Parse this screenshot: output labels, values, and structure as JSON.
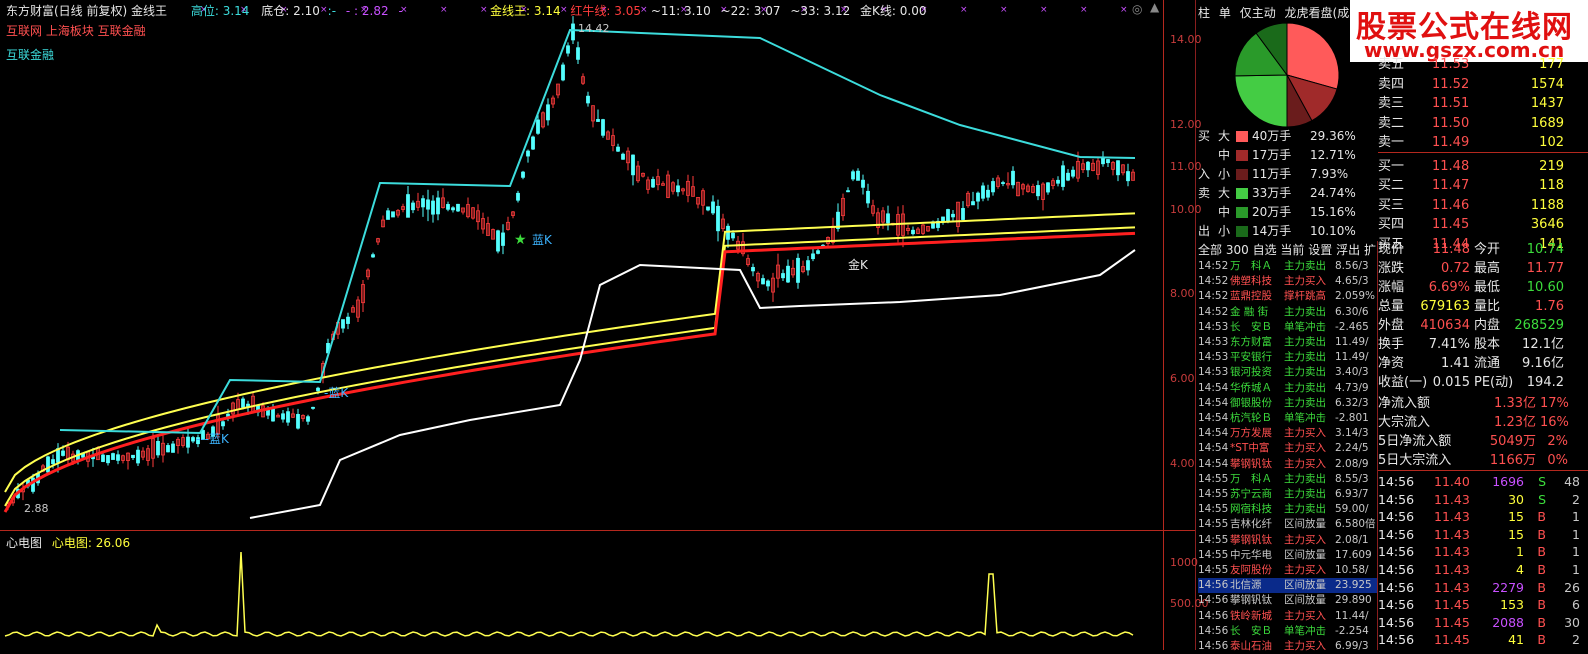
{
  "header": {
    "title": "东方财富(日线 前复权) 金线王",
    "high_label": "高位:",
    "high_value": "3.14",
    "low_label": "底仓:",
    "low_value": "2.10",
    "t3": ":-",
    "t4": "- : 2.82",
    "t5": "-"
  },
  "indicators": {
    "gold_king_label": "金线王:",
    "gold_king_value": "3.14",
    "red_bull_label": "红牛线:",
    "red_bull_value": "3.05",
    "ma11": "~11: 3.10",
    "ma22": "~22: 3.07",
    "ma33": "~33: 3.12",
    "gold_k_label": "金K线:",
    "gold_k_value": "0.00"
  },
  "sectors": {
    "line1": "互联网 上海板块 互联金融",
    "line2": "互联金融"
  },
  "chart_labels": {
    "peak": "14.42",
    "low": "2.88",
    "blue_k": "蓝K",
    "gold_k": "金K",
    "lan_k": "-蓝K",
    "blue_k_lines": "---蓝K"
  },
  "y_axis": [
    "14.00",
    "12.00",
    "11.00",
    "10.00",
    "8.00",
    "6.00",
    "4.00"
  ],
  "lower_panel": {
    "title": "心电图",
    "label": "心电图:",
    "value": "26.06",
    "y_axis": [
      "1000",
      "500.00"
    ]
  },
  "tabs": [
    "柱",
    "单",
    "仅主动",
    "龙虎看盘(成交"
  ],
  "logo": {
    "line1": "股票公式在线网",
    "line2": "www.gszx.com.cn"
  },
  "pie": {
    "slices": [
      {
        "name": "大买",
        "value": 29.36,
        "color": "#ff5a5a"
      },
      {
        "name": "中买",
        "value": 12.71,
        "color": "#a02a2a"
      },
      {
        "name": "小买",
        "value": 7.93,
        "color": "#6a1c1c"
      },
      {
        "name": "大卖",
        "value": 24.74,
        "color": "#44cc44"
      },
      {
        "name": "中卖",
        "value": 15.16,
        "color": "#2a9a2a"
      },
      {
        "name": "小卖",
        "value": 10.1,
        "color": "#1a6a1a"
      }
    ]
  },
  "flows": [
    {
      "side": "买",
      "size": "大",
      "color": "#ff5a5a",
      "amount": "40万手",
      "pct": "29.36%"
    },
    {
      "side": "",
      "size": "中",
      "color": "#a02a2a",
      "amount": "17万手",
      "pct": "12.71%"
    },
    {
      "side": "入",
      "size": "小",
      "color": "#6a1c1c",
      "amount": "11万手",
      "pct": "7.93%"
    },
    {
      "side": "卖",
      "size": "大",
      "color": "#44cc44",
      "amount": "33万手",
      "pct": "24.74%"
    },
    {
      "side": "",
      "size": "中",
      "color": "#2a9a2a",
      "amount": "20万手",
      "pct": "15.16%"
    },
    {
      "side": "出",
      "size": "小",
      "color": "#1a6a1a",
      "amount": "14万手",
      "pct": "10.10%"
    }
  ],
  "order_book": [
    {
      "name": "卖五",
      "price": "11.53",
      "vol": "177"
    },
    {
      "name": "卖四",
      "price": "11.52",
      "vol": "1574"
    },
    {
      "name": "卖三",
      "price": "11.51",
      "vol": "1437"
    },
    {
      "name": "卖二",
      "price": "11.50",
      "vol": "1689"
    },
    {
      "name": "卖一",
      "price": "11.49",
      "vol": "102"
    },
    {
      "name": "买一",
      "price": "11.48",
      "vol": "219"
    },
    {
      "name": "买二",
      "price": "11.47",
      "vol": "118"
    },
    {
      "name": "买三",
      "price": "11.46",
      "vol": "1188"
    },
    {
      "name": "买四",
      "price": "11.45",
      "vol": "3646"
    },
    {
      "name": "买五",
      "price": "11.44",
      "vol": "141"
    }
  ],
  "ticker_tabs": [
    "全部",
    "300",
    "自选",
    "当前",
    "设置",
    "浮出",
    "扩"
  ],
  "ticker": [
    {
      "time": "14:52",
      "name": "万　科Ａ",
      "name_color": "#3cdc3c",
      "type": "主力卖出",
      "type_color": "#3cdc3c",
      "pct": "8.56/3"
    },
    {
      "time": "14:52",
      "name": "佛塑科技",
      "name_color": "#ff5050",
      "type": "主力买入",
      "type_color": "#ff5050",
      "pct": "4.65/3"
    },
    {
      "time": "14:52",
      "name": "蓝鼎控股",
      "name_color": "#ff5050",
      "type": "撑杆跳高",
      "type_color": "#ff5050",
      "pct": "2.059%"
    },
    {
      "time": "14:52",
      "name": "金 融 街",
      "name_color": "#3cdc3c",
      "type": "主力卖出",
      "type_color": "#3cdc3c",
      "pct": "6.30/6"
    },
    {
      "time": "14:53",
      "name": "长　安Ｂ",
      "name_color": "#3cdc3c",
      "type": "单笔冲击",
      "type_color": "#3cdc3c",
      "pct": "-2.465"
    },
    {
      "time": "14:53",
      "name": "东方财富",
      "name_color": "#3cdc3c",
      "type": "主力卖出",
      "type_color": "#3cdc3c",
      "pct": "11.49/"
    },
    {
      "time": "14:53",
      "name": "平安银行",
      "name_color": "#3cdc3c",
      "type": "主力卖出",
      "type_color": "#3cdc3c",
      "pct": "11.49/"
    },
    {
      "time": "14:53",
      "name": "银河投资",
      "name_color": "#3cdc3c",
      "type": "主力卖出",
      "type_color": "#3cdc3c",
      "pct": "3.40/3"
    },
    {
      "time": "14:54",
      "name": "华侨城Ａ",
      "name_color": "#3cdc3c",
      "type": "主力卖出",
      "type_color": "#3cdc3c",
      "pct": "4.73/9"
    },
    {
      "time": "14:54",
      "name": "御银股份",
      "name_color": "#3cdc3c",
      "type": "主力卖出",
      "type_color": "#3cdc3c",
      "pct": "6.32/3"
    },
    {
      "time": "14:54",
      "name": "杭汽轮Ｂ",
      "name_color": "#3cdc3c",
      "type": "单笔冲击",
      "type_color": "#3cdc3c",
      "pct": "-2.801"
    },
    {
      "time": "14:54",
      "name": "万方发展",
      "name_color": "#ff5050",
      "type": "主力买入",
      "type_color": "#ff5050",
      "pct": "3.14/3"
    },
    {
      "time": "14:54",
      "name": "*ST中富",
      "name_color": "#ff5050",
      "type": "主力买入",
      "type_color": "#ff5050",
      "pct": "2.24/5"
    },
    {
      "time": "14:54",
      "name": "攀钢钒钛",
      "name_color": "#ff5050",
      "type": "主力买入",
      "type_color": "#ff5050",
      "pct": "2.08/9"
    },
    {
      "time": "14:55",
      "name": "万　科Ａ",
      "name_color": "#3cdc3c",
      "type": "主力卖出",
      "type_color": "#3cdc3c",
      "pct": "8.55/3"
    },
    {
      "time": "14:55",
      "name": "苏宁云商",
      "name_color": "#3cdc3c",
      "type": "主力卖出",
      "type_color": "#3cdc3c",
      "pct": "6.93/7"
    },
    {
      "time": "14:55",
      "name": "网宿科技",
      "name_color": "#3cdc3c",
      "type": "主力卖出",
      "type_color": "#3cdc3c",
      "pct": "59.00/"
    },
    {
      "time": "14:55",
      "name": "吉林化纤",
      "name_color": "#c8c8c8",
      "type": "区间放量",
      "type_color": "#c8c8c8",
      "pct": "6.580倍"
    },
    {
      "time": "14:55",
      "name": "攀钢钒钛",
      "name_color": "#ff5050",
      "type": "主力买入",
      "type_color": "#ff5050",
      "pct": "2.08/1"
    },
    {
      "time": "14:55",
      "name": "中元华电",
      "name_color": "#c8c8c8",
      "type": "区间放量",
      "type_color": "#c8c8c8",
      "pct": "17.609"
    },
    {
      "time": "14:55",
      "name": "友阿股份",
      "name_color": "#ff5050",
      "type": "主力买入",
      "type_color": "#ff5050",
      "pct": "10.58/"
    },
    {
      "time": "14:56",
      "name": "北信源",
      "name_color": "#c8c8c8",
      "type": "区间放量",
      "type_color": "#c8c8c8",
      "pct": "23.925",
      "highlight": true
    },
    {
      "time": "14:56",
      "name": "攀钢钒钛",
      "name_color": "#c8c8c8",
      "type": "区间放量",
      "type_color": "#c8c8c8",
      "pct": "29.890"
    },
    {
      "time": "14:56",
      "name": "铁岭新城",
      "name_color": "#ff5050",
      "type": "主力买入",
      "type_color": "#ff5050",
      "pct": "11.44/"
    },
    {
      "time": "14:56",
      "name": "长　安Ｂ",
      "name_color": "#3cdc3c",
      "type": "单笔冲击",
      "type_color": "#3cdc3c",
      "pct": "-2.254"
    },
    {
      "time": "14:56",
      "name": "泰山石油",
      "name_color": "#ff5050",
      "type": "主力买入",
      "type_color": "#ff5050",
      "pct": "6.99/3"
    }
  ],
  "quote": {
    "rows": [
      {
        "l1": "现价",
        "v1": "11.48",
        "c1": "#ff5050",
        "l2": "今开",
        "v2": "10.74",
        "c2": "#3cdc3c"
      },
      {
        "l1": "涨跌",
        "v1": "0.72",
        "c1": "#ff5050",
        "l2": "最高",
        "v2": "11.77",
        "c2": "#ff5050"
      },
      {
        "l1": "涨幅",
        "v1": "6.69%",
        "c1": "#ff5050",
        "l2": "最低",
        "v2": "10.60",
        "c2": "#3cdc3c"
      },
      {
        "l1": "总量",
        "v1": "679163",
        "c1": "#ffff3c",
        "l2": "量比",
        "v2": "1.76",
        "c2": "#ff5050"
      },
      {
        "l1": "外盘",
        "v1": "410634",
        "c1": "#ff5050",
        "l2": "内盘",
        "v2": "268529",
        "c2": "#3cdc3c"
      },
      {
        "l1": "换手",
        "v1": "7.41%",
        "c1": "#e6e6e6",
        "l2": "股本",
        "v2": "12.1亿",
        "c2": "#e6e6e6"
      },
      {
        "l1": "净资",
        "v1": "1.41",
        "c1": "#e6e6e6",
        "l2": "流通",
        "v2": "9.16亿",
        "c2": "#e6e6e6"
      },
      {
        "l1": "收益(一)",
        "v1": "0.015",
        "c1": "#e6e6e6",
        "l2": "PE(动)",
        "v2": "194.2",
        "c2": "#e6e6e6"
      }
    ],
    "flows": [
      {
        "label": "净流入额",
        "value": "1.33亿",
        "pct": "17%"
      },
      {
        "label": "大宗流入",
        "value": "1.23亿",
        "pct": "16%"
      },
      {
        "label": "5日净流入额",
        "value": "5049万",
        "pct": "2%"
      },
      {
        "label": "5日大宗流入",
        "value": "1166万",
        "pct": "0%"
      }
    ]
  },
  "trades": [
    {
      "time": "14:56",
      "price": "11.40",
      "vol": "1696",
      "vol_color": "#c850ff",
      "side": "S",
      "side_color": "#3cdc3c",
      "cnt": "48"
    },
    {
      "time": "14:56",
      "price": "11.43",
      "vol": "30",
      "vol_color": "#ffff3c",
      "side": "S",
      "side_color": "#3cdc3c",
      "cnt": "2"
    },
    {
      "time": "14:56",
      "price": "11.43",
      "vol": "15",
      "vol_color": "#ffff3c",
      "side": "B",
      "side_color": "#ff5050",
      "cnt": "1"
    },
    {
      "time": "14:56",
      "price": "11.43",
      "vol": "15",
      "vol_color": "#ffff3c",
      "side": "B",
      "side_color": "#ff5050",
      "cnt": "1"
    },
    {
      "time": "14:56",
      "price": "11.43",
      "vol": "1",
      "vol_color": "#ffff3c",
      "side": "B",
      "side_color": "#ff5050",
      "cnt": "1"
    },
    {
      "time": "14:56",
      "price": "11.43",
      "vol": "4",
      "vol_color": "#ffff3c",
      "side": "B",
      "side_color": "#ff5050",
      "cnt": "1"
    },
    {
      "time": "14:56",
      "price": "11.43",
      "vol": "2279",
      "vol_color": "#c850ff",
      "side": "B",
      "side_color": "#ff5050",
      "cnt": "26"
    },
    {
      "time": "14:56",
      "price": "11.45",
      "vol": "153",
      "vol_color": "#ffff3c",
      "side": "B",
      "side_color": "#ff5050",
      "cnt": "6"
    },
    {
      "time": "14:56",
      "price": "11.45",
      "vol": "2088",
      "vol_color": "#c850ff",
      "side": "B",
      "side_color": "#ff5050",
      "cnt": "30"
    },
    {
      "time": "14:56",
      "price": "11.45",
      "vol": "41",
      "vol_color": "#ffff3c",
      "side": "B",
      "side_color": "#ff5050",
      "cnt": "2"
    }
  ]
}
